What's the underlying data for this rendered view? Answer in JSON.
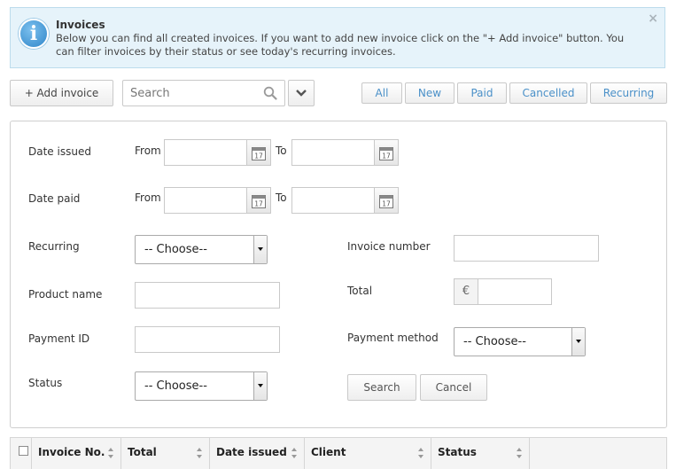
{
  "info": {
    "title": "Invoices",
    "text": "Below you can find all created invoices. If you want to add new invoice click on the \"+ Add invoice\" button. You can filter invoices by their status or see today's recurring invoices.",
    "close": "×"
  },
  "toolbar": {
    "add_label": "+ Add invoice",
    "search_placeholder": "Search",
    "filters": [
      "All",
      "New",
      "Paid",
      "Cancelled",
      "Recurring"
    ]
  },
  "filter_form": {
    "date_issued_label": "Date issued",
    "date_paid_label": "Date paid",
    "from_label": "From",
    "to_label": "To",
    "recurring_label": "Recurring",
    "recurring_value": "-- Choose--",
    "invoice_number_label": "Invoice number",
    "product_name_label": "Product name",
    "total_label": "Total",
    "currency_symbol": "€",
    "payment_id_label": "Payment ID",
    "payment_method_label": "Payment method",
    "payment_method_value": "-- Choose--",
    "status_label": "Status",
    "status_value": "-- Choose--",
    "search_button": "Search",
    "cancel_button": "Cancel",
    "calendar_day": "17"
  },
  "table": {
    "columns": [
      "Invoice No.",
      "Total",
      "Date issued",
      "Client",
      "Status"
    ]
  },
  "colors": {
    "accent": "#4a90c8",
    "info_bg": "#e6f3fa"
  }
}
